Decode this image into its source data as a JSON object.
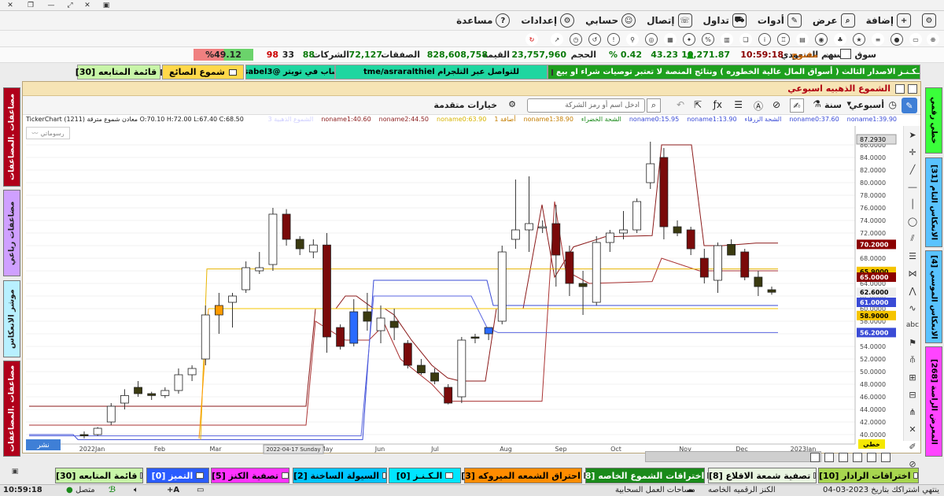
{
  "menu": {
    "items": [
      "إضافة",
      "عرض",
      "أدوات",
      "تداول",
      "إتصال",
      "حسابي",
      "إعدادات",
      "مساعدة"
    ],
    "icons": [
      "add-icon",
      "view-icon",
      "tools-icon",
      "trade-icon",
      "connect-icon",
      "account-icon",
      "settings-icon",
      "help-icon"
    ]
  },
  "stats": {
    "market": "سوق الأسهم السعودي",
    "status": "مفتوح",
    "time": "10:59:18",
    "index": "10,271.87",
    "change": "43.23",
    "change_pct": "% 0.42",
    "volume_label": "الحجم",
    "volume": "23,757,960",
    "value_label": "القيمة",
    "value": "828,608,758",
    "trades_label": "الصفقات",
    "trades": "72,127",
    "companies_label": "الشركات",
    "up": "88",
    "unchanged": "33",
    "down": "98",
    "breadth": "%49.12"
  },
  "ticker": {
    "news": "مـسـصة الـكـنـز الاصدار الثالث ( أسواق المال عالية الخطوره ) ونتائج المنصة لا تعتبر توصيات شراء او بيع",
    "telegram": "للتواصل عبر التلجرام   tme/asraralthiel",
    "twitter": "او الحساب في تويتر @aber_sabel3",
    "candles_btn": "شموع الصائع",
    "watchlist_btn": "قائمة المتابعه [30]"
  },
  "left_panels": [
    "مضاعفات .المضاعفات",
    "مضاعفات رباعي",
    "موشر الانعكاس",
    "مضاعفات .المضاعفات"
  ],
  "right_panels": [
    "خطي رقمي",
    "الانعكاس التام [31]",
    "الانعكاس الموسي [4]",
    "المعرض الراصة [268]"
  ],
  "chart_window": {
    "title": "الشموع الذهبيه اسبوعي",
    "year_label": "سنة",
    "period_label": "أسبوعي",
    "search_placeholder": "ادخل اسم أو رمز الشركة",
    "advanced": "خيارات متقدمة",
    "ohlc": "TickerChart (1211) معادن شموع مترقة O:70.10 H:72.00 L:67.40 C:68.50",
    "legend": [
      {
        "text": "noname1:39.90",
        "color": "#3a4bd6"
      },
      {
        "text": "noname0:37.60",
        "color": "#3a4bd6"
      },
      {
        "text": "الشحة الزرقاء",
        "color": "#3a4bd6"
      },
      {
        "text": "noname1:13.90",
        "color": "#3a4bd6"
      },
      {
        "text": "noname0:15.95",
        "color": "#3a4bd6"
      },
      {
        "text": "الشحة الخضراء",
        "color": "#1a8a1a"
      },
      {
        "text": "noname1:38.90",
        "color": "#c47d00"
      },
      {
        "text": "1 أضافة",
        "color": "#c47d00"
      },
      {
        "text": "noname0:63.90",
        "color": "#d7b400"
      },
      {
        "text": "noname2:44.50",
        "color": "#8a1c1c"
      },
      {
        "text": "noname1:40.60",
        "color": "#8a1c1c"
      },
      {
        "text": "الشموع الذهبية 3",
        "color": "#d0d0ff"
      }
    ],
    "chart_label": "رسوماتي",
    "draw_label": "نشر",
    "linear_label": "خطي",
    "cursor_price": "87.2930",
    "date_tag": "2022-04-17 Sunday"
  },
  "chart_data": {
    "type": "candlestick",
    "x_ticks": [
      "2022Jan",
      "Feb",
      "Mar",
      "May",
      "Jun",
      "Jul",
      "Aug",
      "Sep",
      "Oct",
      "Nov",
      "Dec",
      "2023Jan"
    ],
    "y_ticks": [
      "40.0000",
      "42.0000",
      "44.0000",
      "46.0000",
      "48.0000",
      "50.0000",
      "52.0000",
      "54.0000",
      "56.0000",
      "58.0000",
      "60.0000",
      "62.0000",
      "64.0000",
      "66.0000",
      "68.0000",
      "70.0000",
      "72.0000",
      "74.0000",
      "76.0000",
      "78.0000",
      "80.0000",
      "82.0000",
      "84.0000",
      "86.0000"
    ],
    "ylim": [
      39.5,
      88
    ],
    "price_tags": [
      {
        "value": "70.2000",
        "color": "#8b0000"
      },
      {
        "value": "65.9000",
        "color": "#f5c400"
      },
      {
        "value": "65.0000",
        "color": "#8b0000"
      },
      {
        "value": "62.6000",
        "color": "#eeeeee"
      },
      {
        "value": "61.0000",
        "color": "#3a4bd6"
      },
      {
        "value": "58.9000",
        "color": "#f5c400"
      },
      {
        "value": "56.2000",
        "color": "#3a4bd6"
      }
    ],
    "candles": [
      {
        "o": 40.0,
        "h": 40.5,
        "l": 39.4,
        "c": 39.8
      },
      {
        "o": 40.0,
        "h": 41.2,
        "l": 39.8,
        "c": 41.0
      },
      {
        "o": 42.0,
        "h": 45.0,
        "l": 41.5,
        "c": 44.5
      },
      {
        "o": 45.0,
        "h": 47.2,
        "l": 44.0,
        "c": 46.2
      },
      {
        "o": 47.5,
        "h": 48.5,
        "l": 46.0,
        "c": 46.5
      },
      {
        "o": 46.5,
        "h": 46.8,
        "l": 45.5,
        "c": 46.2
      },
      {
        "o": 46.2,
        "h": 47.5,
        "l": 45.8,
        "c": 47.0
      },
      {
        "o": 47.0,
        "h": 50.5,
        "l": 46.5,
        "c": 49.5
      },
      {
        "o": 49.5,
        "h": 51.0,
        "l": 48.5,
        "c": 50.5
      },
      {
        "o": 52.0,
        "h": 60.5,
        "l": 51.0,
        "c": 59.0
      },
      {
        "o": 59.0,
        "h": 62.5,
        "l": 56.0,
        "c": 60.5
      },
      {
        "o": 61.0,
        "h": 62.5,
        "l": 57.0,
        "c": 62.0
      },
      {
        "o": 63.0,
        "h": 67.5,
        "l": 62.5,
        "c": 66.5
      },
      {
        "o": 66.0,
        "h": 69.0,
        "l": 65.5,
        "c": 66.5
      },
      {
        "o": 67.0,
        "h": 76.0,
        "l": 66.0,
        "c": 75.0
      },
      {
        "o": 75.0,
        "h": 75.8,
        "l": 70.0,
        "c": 71.0
      },
      {
        "o": 71.0,
        "h": 71.5,
        "l": 68.5,
        "c": 69.5
      },
      {
        "o": 69.0,
        "h": 71.0,
        "l": 68.0,
        "c": 70.1
      },
      {
        "o": 70.1,
        "h": 72.0,
        "l": 53.0,
        "c": 55.5
      },
      {
        "o": 57.0,
        "h": 57.5,
        "l": 53.5,
        "c": 54.0
      },
      {
        "o": 54.5,
        "h": 61.5,
        "l": 54.0,
        "c": 59.5
      },
      {
        "o": 59.5,
        "h": 62.5,
        "l": 56.5,
        "c": 58.0
      },
      {
        "o": 56.5,
        "h": 60.5,
        "l": 54.5,
        "c": 58.5
      },
      {
        "o": 58.0,
        "h": 60.0,
        "l": 55.0,
        "c": 57.0
      },
      {
        "o": 54.5,
        "h": 55.0,
        "l": 50.5,
        "c": 51.0
      },
      {
        "o": 51.0,
        "h": 52.0,
        "l": 49.5,
        "c": 49.8
      },
      {
        "o": 49.8,
        "h": 50.5,
        "l": 48.0,
        "c": 48.5
      },
      {
        "o": 47.5,
        "h": 48.0,
        "l": 44.8,
        "c": 45.0
      },
      {
        "o": 46.0,
        "h": 55.5,
        "l": 45.0,
        "c": 55.0
      },
      {
        "o": 55.5,
        "h": 56.0,
        "l": 54.5,
        "c": 55.3
      },
      {
        "o": 56.0,
        "h": 57.0,
        "l": 55.0,
        "c": 57.0
      },
      {
        "o": 58.0,
        "h": 70.0,
        "l": 57.5,
        "c": 69.0
      },
      {
        "o": 71.0,
        "h": 80.5,
        "l": 69.5,
        "c": 72.5
      },
      {
        "o": 72.5,
        "h": 81.0,
        "l": 69.0,
        "c": 73.5
      },
      {
        "o": 73.0,
        "h": 74.0,
        "l": 72.0,
        "c": 73.0
      },
      {
        "o": 73.5,
        "h": 76.5,
        "l": 63.5,
        "c": 68.5
      },
      {
        "o": 69.0,
        "h": 70.0,
        "l": 62.0,
        "c": 64.0
      },
      {
        "o": 64.0,
        "h": 66.0,
        "l": 59.0,
        "c": 63.5
      },
      {
        "o": 61.0,
        "h": 71.5,
        "l": 60.5,
        "c": 70.5
      },
      {
        "o": 70.5,
        "h": 72.5,
        "l": 69.0,
        "c": 72.0
      },
      {
        "o": 72.0,
        "h": 75.5,
        "l": 71.0,
        "c": 72.5
      },
      {
        "o": 72.5,
        "h": 77.5,
        "l": 72.0,
        "c": 77.0
      },
      {
        "o": 80.0,
        "h": 86.5,
        "l": 79.0,
        "c": 83.0
      },
      {
        "o": 84.0,
        "h": 85.5,
        "l": 71.0,
        "c": 73.0
      },
      {
        "o": 73.0,
        "h": 74.0,
        "l": 71.5,
        "c": 72.0
      },
      {
        "o": 72.5,
        "h": 73.0,
        "l": 68.5,
        "c": 69.5
      },
      {
        "o": 68.0,
        "h": 69.5,
        "l": 64.0,
        "c": 65.0
      },
      {
        "o": 64.5,
        "h": 70.5,
        "l": 62.5,
        "c": 70.0
      },
      {
        "o": 70.2,
        "h": 71.0,
        "l": 68.5,
        "c": 68.5
      },
      {
        "o": 69.0,
        "h": 69.5,
        "l": 64.5,
        "c": 65.0
      },
      {
        "o": 65.0,
        "h": 66.0,
        "l": 62.0,
        "c": 63.5
      },
      {
        "o": 63.0,
        "h": 63.5,
        "l": 62.2,
        "c": 62.6
      }
    ]
  },
  "bottom_tabs": [
    {
      "label": "اختراقات الرادار [10]",
      "bg": "#a7d64f"
    },
    {
      "label": "تصفية شمعة الاقلاع [8]",
      "bg": "#e8f5e0"
    },
    {
      "label": "اختراقات الشموع الخاصه [8]",
      "bg": "#1a8a1a"
    },
    {
      "label": "احتراق الشمعه الميروكه [3]",
      "bg": "#ff8c00"
    },
    {
      "label": "الـكـنـز [0]",
      "bg": "#00e5ff"
    },
    {
      "label": "السيولة الساخنة [2]",
      "bg": "#00c4ff"
    },
    {
      "label": "تصفية الكنز [5]",
      "bg": "#ff33ff"
    },
    {
      "label": "التميز [0]",
      "bg": "#2a5bff"
    },
    {
      "label": "قائمة المتابعه [30]",
      "bg": "#c8f5a8"
    }
  ],
  "status": {
    "subscription": "ينتهي اشتراكك بتاريخ 2023-03-04",
    "package": "الكنز الرقميه الخاصه",
    "cloud": "مساحات العمل السحابية",
    "connected": "متصل",
    "time": "10:59:18"
  }
}
